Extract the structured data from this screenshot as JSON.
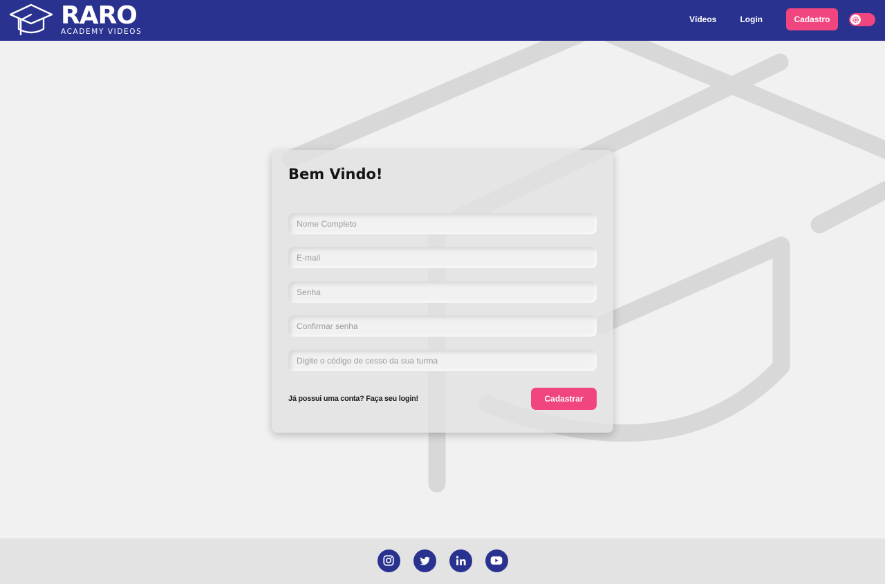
{
  "brand": {
    "name": "RARO",
    "subtitle": "ACADEMY VIDEOS"
  },
  "nav": {
    "videos_label": "Vídeos",
    "login_label": "Login",
    "signup_label": "Cadastro",
    "theme_toggle": {
      "icon": "gear-icon",
      "state": "on"
    }
  },
  "form": {
    "title": "Bem Vindo!",
    "fields": {
      "name_placeholder": "Nome Completo",
      "email_placeholder": "E-mail",
      "password_placeholder": "Senha",
      "confirm_placeholder": "Confirmar senha",
      "code_placeholder": "Digite o código de cesso da sua turma"
    },
    "login_link": "Já possui uma conta? Faça seu login!",
    "submit_label": "Cadastrar"
  },
  "footer": {
    "socials": [
      "instagram-icon",
      "twitter-icon",
      "linkedin-icon",
      "youtube-icon"
    ]
  },
  "colors": {
    "primary": "#2a3290",
    "accent": "#f0457e",
    "background": "#f1f1f1",
    "footer": "#e3e3e3"
  }
}
